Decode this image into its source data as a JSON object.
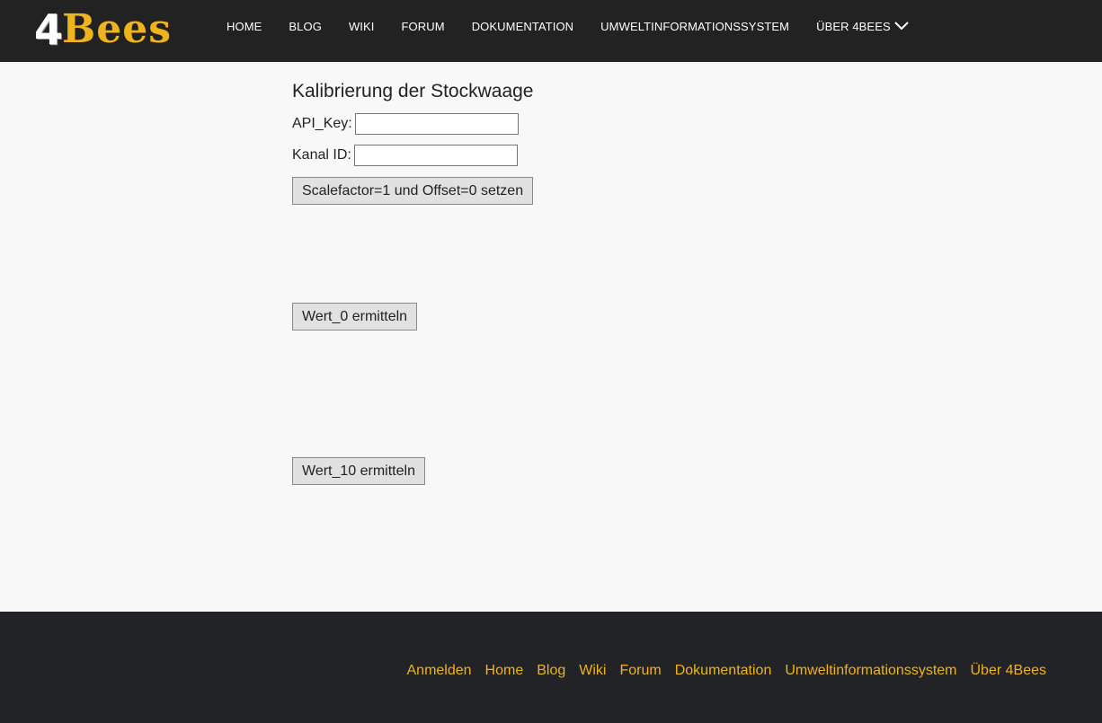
{
  "header": {
    "logo_number": "4",
    "logo_word": "Bees",
    "nav": [
      "HOME",
      "BLOG",
      "WIKI",
      "FORUM",
      "DOKUMENTATION",
      "UMWELTINFORMATIONSSYSTEM",
      "ÜBER 4BEES"
    ],
    "dropdown_icon": "chevron-down-icon"
  },
  "main": {
    "title": "Kalibrierung der Stockwaage",
    "api_key_label": "API_Key:",
    "api_key_value": "",
    "kanal_label": "Kanal ID:",
    "kanal_value": "",
    "scale_button": "Scalefactor=1 und Offset=0 setzen",
    "wert0_button": "Wert_0 ermitteln",
    "wert10_button": "Wert_10 ermitteln"
  },
  "footer": {
    "links": [
      "Anmelden",
      "Home",
      "Blog",
      "Wiki",
      "Forum",
      "Dokumentation",
      "Umweltinformationssystem",
      "Über 4Bees"
    ]
  },
  "colors": {
    "topbar": "#222222",
    "accent": "#eeb31f",
    "page_bg": "#f8f8f8",
    "footer": "#222327"
  }
}
